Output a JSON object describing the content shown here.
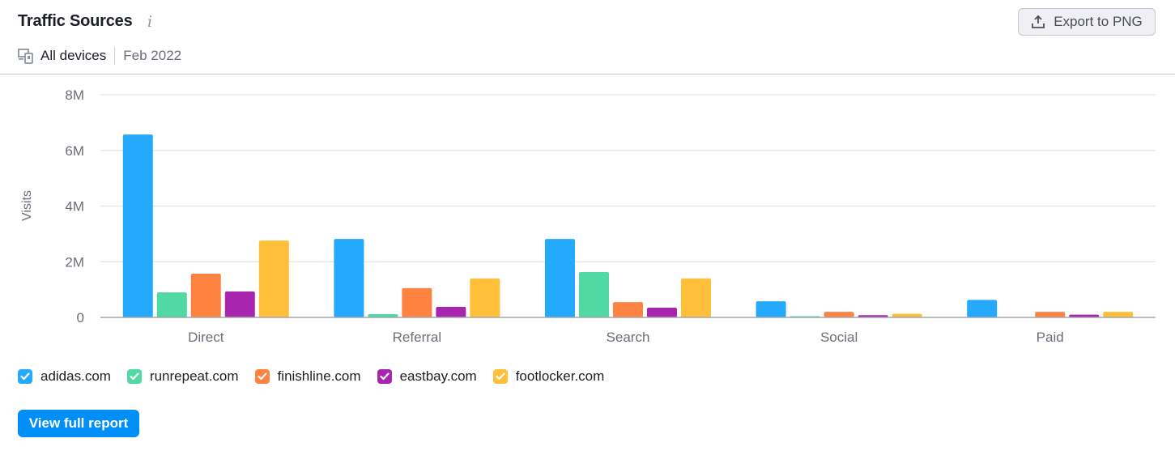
{
  "header": {
    "title": "Traffic Sources",
    "info_icon": "info-icon",
    "device_filter": "All devices",
    "date": "Feb 2022",
    "export_label": "Export to PNG"
  },
  "footer": {
    "view_report_label": "View full report"
  },
  "chart_data": {
    "type": "bar",
    "title": "Traffic Sources",
    "xlabel": "",
    "ylabel": "Visits",
    "ylim": [
      0,
      8000000
    ],
    "yticks": [
      0,
      2000000,
      4000000,
      6000000,
      8000000
    ],
    "ytick_labels": [
      "0",
      "2M",
      "4M",
      "6M",
      "8M"
    ],
    "grid": true,
    "legend_position": "bottom-left",
    "categories": [
      "Direct",
      "Referral",
      "Search",
      "Social",
      "Paid"
    ],
    "series": [
      {
        "name": "adidas.com",
        "color": "#25a9fd",
        "values": [
          6570000,
          2820000,
          2820000,
          580000,
          630000
        ]
      },
      {
        "name": "runrepeat.com",
        "color": "#50d9a0",
        "values": [
          900000,
          120000,
          1630000,
          20000,
          0
        ]
      },
      {
        "name": "finishline.com",
        "color": "#ff8340",
        "values": [
          1570000,
          1050000,
          550000,
          200000,
          200000
        ]
      },
      {
        "name": "eastbay.com",
        "color": "#a826af",
        "values": [
          930000,
          380000,
          350000,
          80000,
          100000
        ]
      },
      {
        "name": "footlocker.com",
        "color": "#ffbf38",
        "values": [
          2760000,
          1400000,
          1400000,
          130000,
          200000
        ]
      }
    ]
  }
}
